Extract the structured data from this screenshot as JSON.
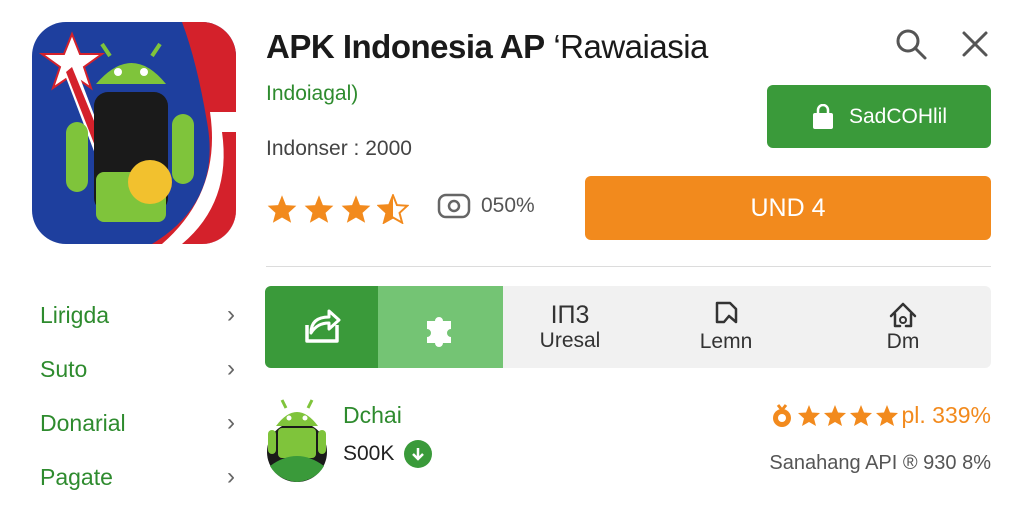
{
  "app": {
    "title_bold": "APK Indonesia AP",
    "title_tail": " ‘Rawaiasia",
    "developer": "Indoiagal)",
    "meta": "Indonser : 2000",
    "rating_stars": 3.5,
    "rating_count": "050%"
  },
  "buttons": {
    "secondary_label": "SadCOHlil",
    "primary_label": "UND 4"
  },
  "sidebar": {
    "items": [
      {
        "label": "Lirigda"
      },
      {
        "label": "Suto"
      },
      {
        "label": "Donarial"
      },
      {
        "label": "Pagate"
      }
    ]
  },
  "tabs": [
    {
      "icon": "share-icon",
      "label": ""
    },
    {
      "icon": "puzzle-icon",
      "label": ""
    },
    {
      "big": "IП3",
      "label": "Uresal"
    },
    {
      "icon": "bookmark-icon",
      "label": "Lemn"
    },
    {
      "icon": "home-icon",
      "label": "Dm"
    }
  ],
  "developer_row": {
    "name": "Dchai",
    "count": "S00K",
    "rating_text": "pl. 339%",
    "sub_text": "Sanahang API  ® 930 8%"
  },
  "colors": {
    "green": "#3a9a3a",
    "light_green": "#74c474",
    "orange": "#f28a1d"
  }
}
